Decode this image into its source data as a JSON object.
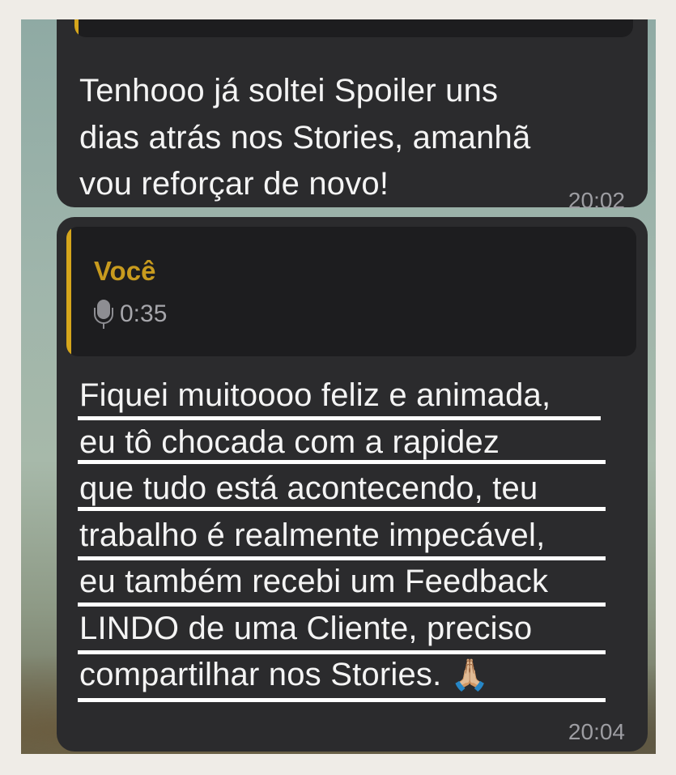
{
  "messages": [
    {
      "text": "Tenhooo já soltei Spoiler uns\ndias atrás nos Stories, amanhã\nvou reforçar de novo!",
      "time": "20:02"
    },
    {
      "reply": {
        "author": "Você",
        "icon": "microphone-icon",
        "duration": "0:35"
      },
      "text": "Fiquei muitoooo feliz e animada,\neu tô chocada com a rapidez\nque tudo está acontecendo, teu\ntrabalho é realmente impecável,\neu também recebi um Feedback\nLINDO de uma Cliente, preciso\ncompartilhar nos Stories.",
      "emoji": "🙏🏼",
      "time": "20:04"
    }
  ],
  "colors": {
    "bubble": "#2b2b2d",
    "quote_bg": "#1d1d1f",
    "accent": "#d6a61c",
    "timestamp": "#9d9da2",
    "underline": "#ffffff"
  }
}
